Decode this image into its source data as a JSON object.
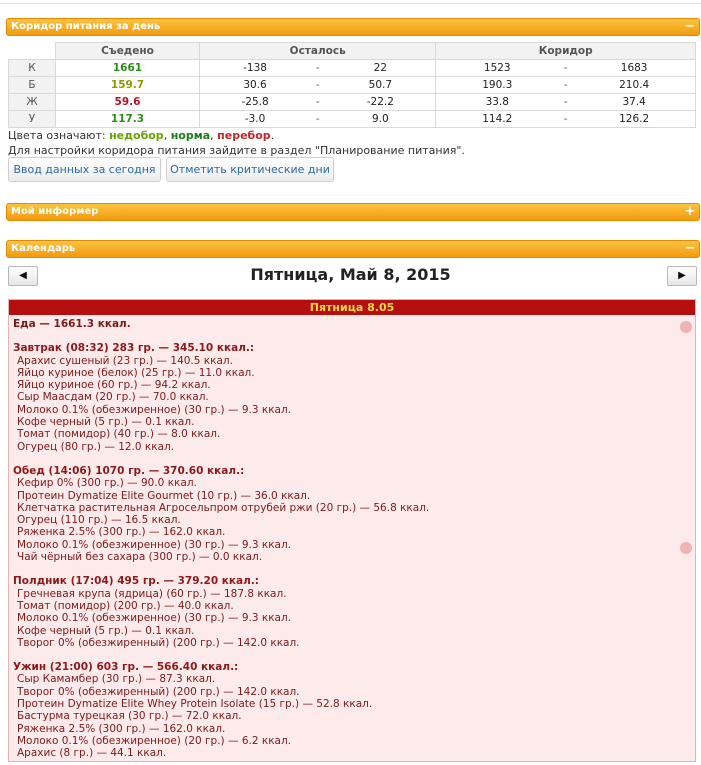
{
  "panels": {
    "corridor_title": "Коридор питания за день",
    "informer_title": "Мой информер",
    "calendar_title": "Календарь",
    "collapse_icon": "−",
    "expand_icon": "+"
  },
  "corridor": {
    "headers": {
      "eaten": "Съедено",
      "left": "Осталось",
      "corridor": "Коридор"
    },
    "dash": "-",
    "rows": [
      {
        "label": "К",
        "eaten": "1661",
        "status": "g",
        "left_min": "-138",
        "left_max": "22",
        "c_min": "1523",
        "c_max": "1683"
      },
      {
        "label": "Б",
        "eaten": "159.7",
        "status": "o",
        "left_min": "30.6",
        "left_max": "50.7",
        "c_min": "190.3",
        "c_max": "210.4"
      },
      {
        "label": "Ж",
        "eaten": "59.6",
        "status": "r",
        "left_min": "-25.8",
        "left_max": "-22.2",
        "c_min": "33.8",
        "c_max": "37.4"
      },
      {
        "label": "У",
        "eaten": "117.3",
        "status": "g",
        "left_min": "-3.0",
        "left_max": "9.0",
        "c_min": "114.2",
        "c_max": "126.2"
      }
    ],
    "legend_prefix": "Цвета означают: ",
    "legend_under": "недобор",
    "legend_norm": "норма",
    "legend_over": "перебор",
    "hint": "Для настройки коридора питания зайдите в раздел \"Планирование питания\".",
    "btn_today": "Ввод данных за сегодня",
    "btn_critical": "Отметить критические дни"
  },
  "calendar": {
    "title": "Пятница, Май 8, 2015",
    "prev": "◀",
    "next": "▶",
    "day_header": "Пятница 8.05",
    "total": "Еда — 1661.3 ккал.",
    "meals": [
      {
        "head": "Завтрак (08:32) 283 гр. — 345.10 ккал.:",
        "items": [
          "Арахис сушеный (23 гр.) — 140.5 ккал.",
          "Яйцо куриное (белок) (25 гр.) — 11.0 ккал.",
          "Яйцо куриное (60 гр.) — 94.2 ккал.",
          "Сыр Маасдам (20 гр.) — 70.0 ккал.",
          "Молоко 0.1% (обезжиренное) (30 гр.) — 9.3 ккал.",
          "Кофе черный (5 гр.) — 0.1 ккал.",
          "Томат (помидор) (40 гр.) — 8.0 ккал.",
          "Огурец (80 гр.) — 12.0 ккал."
        ]
      },
      {
        "head": "Обед (14:06) 1070 гр. — 370.60 ккал.:",
        "items": [
          "Кефир 0% (300 гр.) — 90.0 ккал.",
          "Протеин Dymatize Elite Gourmet (10 гр.) — 36.0 ккал.",
          "Клетчатка растительная Агросельпром отрубей ржи (20 гр.) — 56.8 ккал.",
          "Огурец (110 гр.) — 16.5 ккал.",
          "Ряженка 2.5% (300 гр.) — 162.0 ккал.",
          "Молоко 0.1% (обезжиренное) (30 гр.) — 9.3 ккал.",
          "Чай чёрный без сахара (300 гр.) — 0.0 ккал."
        ]
      },
      {
        "head": "Полдник (17:04) 495 гр. — 379.20 ккал.:",
        "items": [
          "Гречневая крупа (ядрица) (60 гр.) — 187.8 ккал.",
          "Томат (помидор) (200 гр.) — 40.0 ккал.",
          "Молоко 0.1% (обезжиренное) (30 гр.) — 9.3 ккал.",
          "Кофе черный (5 гр.) — 0.1 ккал.",
          "Творог 0% (обезжиренный) (200 гр.) — 142.0 ккал."
        ]
      },
      {
        "head": "Ужин (21:00) 603 гр. — 566.40 ккал.:",
        "items": [
          "Сыр Камамбер (30 гр.) — 87.3 ккал.",
          "Творог 0% (обезжиренный) (200 гр.) — 142.0 ккал.",
          "Протеин Dymatize Elite Whey Protein Isolate (15 гр.) — 52.8 ккал.",
          "Бастурма турецкая (30 гр.) — 72.0 ккал.",
          "Ряженка 2.5% (300 гр.) — 162.0 ккал.",
          "Молоко 0.1% (обезжиренное) (20 гр.) — 6.2 ккал.",
          "Арахис (8 гр.) — 44.1 ккал."
        ]
      }
    ]
  }
}
